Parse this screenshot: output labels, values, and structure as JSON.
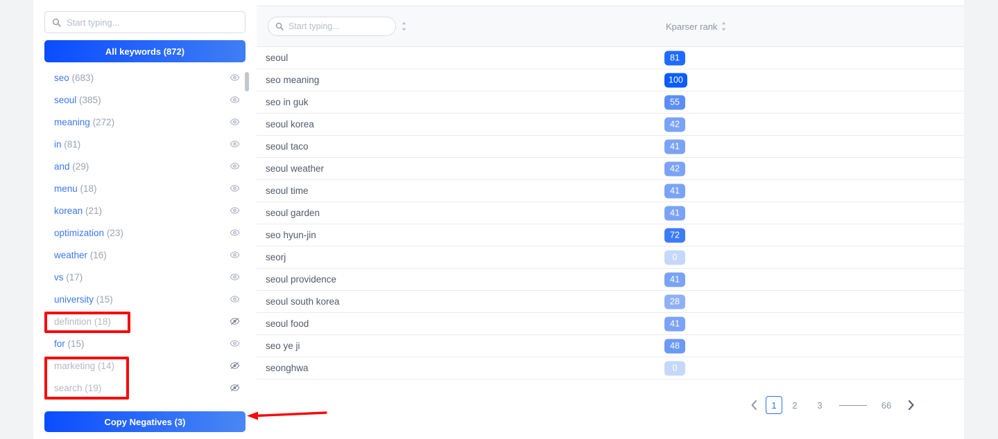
{
  "sidebar": {
    "search": {
      "placeholder": "Start typing...",
      "value": "",
      "icon": "search-icon"
    },
    "all_keywords_label": "All keywords (872)",
    "copy_negatives_label": "Copy Negatives (3)",
    "eye_icon": "eye-icon",
    "eye_off_icon": "eye-off-icon",
    "items": [
      {
        "label": "seo",
        "count": "(683)",
        "enabled": true
      },
      {
        "label": "seoul",
        "count": "(385)",
        "enabled": true
      },
      {
        "label": "meaning",
        "count": "(272)",
        "enabled": true
      },
      {
        "label": "in",
        "count": "(81)",
        "enabled": true
      },
      {
        "label": "and",
        "count": "(29)",
        "enabled": true
      },
      {
        "label": "menu",
        "count": "(18)",
        "enabled": true
      },
      {
        "label": "korean",
        "count": "(21)",
        "enabled": true
      },
      {
        "label": "optimization",
        "count": "(23)",
        "enabled": true
      },
      {
        "label": "weather",
        "count": "(16)",
        "enabled": true
      },
      {
        "label": "vs",
        "count": "(17)",
        "enabled": true
      },
      {
        "label": "university",
        "count": "(15)",
        "enabled": true
      },
      {
        "label": "definition",
        "count": "(18)",
        "enabled": false
      },
      {
        "label": "for",
        "count": "(15)",
        "enabled": true
      },
      {
        "label": "marketing",
        "count": "(14)",
        "enabled": false
      },
      {
        "label": "search",
        "count": "(19)",
        "enabled": false
      }
    ]
  },
  "table": {
    "search": {
      "placeholder": "Start typing...",
      "value": "",
      "icon": "search-icon"
    },
    "sort_icon": "sort-updown-icon",
    "rank_column_header": "Kparser rank",
    "rows": [
      {
        "keyword": "seoul",
        "rank": "81",
        "color": "#1f6bff"
      },
      {
        "keyword": "seo meaning",
        "rank": "100",
        "color": "#0a5cff"
      },
      {
        "keyword": "seo in guk",
        "rank": "55",
        "color": "#5b8ef7"
      },
      {
        "keyword": "seoul korea",
        "rank": "42",
        "color": "#7ba3f5"
      },
      {
        "keyword": "seoul taco",
        "rank": "41",
        "color": "#7ba3f5"
      },
      {
        "keyword": "seoul weather",
        "rank": "42",
        "color": "#7ba3f5"
      },
      {
        "keyword": "seoul time",
        "rank": "41",
        "color": "#7ba3f5"
      },
      {
        "keyword": "seoul garden",
        "rank": "41",
        "color": "#7ba3f5"
      },
      {
        "keyword": "seo hyun-jin",
        "rank": "72",
        "color": "#3e7bf8"
      },
      {
        "keyword": "seorj",
        "rank": "0",
        "color": "#c5d8fa"
      },
      {
        "keyword": "seoul providence",
        "rank": "41",
        "color": "#7ba3f5"
      },
      {
        "keyword": "seoul south korea",
        "rank": "28",
        "color": "#8fb0f7"
      },
      {
        "keyword": "seoul food",
        "rank": "41",
        "color": "#7ba3f5"
      },
      {
        "keyword": "seo ye ji",
        "rank": "48",
        "color": "#6b99f6"
      },
      {
        "keyword": "seonghwa",
        "rank": "0",
        "color": "#c5d8fa"
      },
      {
        "keyword": "",
        "rank": "",
        "color": "#1f6bff"
      }
    ]
  },
  "pagination": {
    "prev_icon": "chevron-left-icon",
    "next_icon": "chevron-right-icon",
    "pages": [
      "1",
      "2",
      "3"
    ],
    "active_page": "1",
    "last_page": "66"
  },
  "annotations": {
    "box_color": "#f60b0b",
    "arrow_color": "#f60b0b"
  }
}
